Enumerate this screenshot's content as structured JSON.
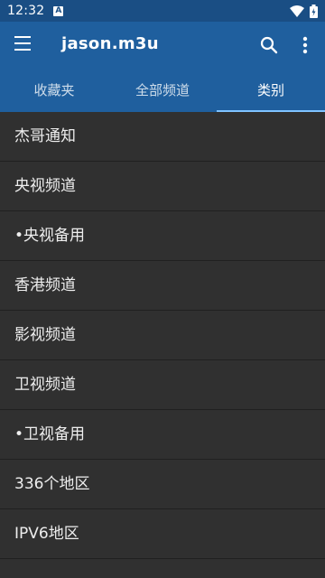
{
  "status_bar": {
    "time": "12:32",
    "notification_icon": "A"
  },
  "app_bar": {
    "title": "jason.m3u"
  },
  "tabs": [
    {
      "label": "收藏夹",
      "active": false
    },
    {
      "label": "全部频道",
      "active": false
    },
    {
      "label": "类别",
      "active": true
    }
  ],
  "categories": [
    "杰哥通知",
    "央视频道",
    "•央视备用",
    "香港频道",
    "影视频道",
    "卫视频道",
    "•卫视备用",
    "336个地区",
    "IPV6地区"
  ],
  "colors": {
    "status_bar": "#1a4e84",
    "app_bar": "#1f5f9e",
    "tab_indicator": "#7fc3ff",
    "list_background": "#303030"
  }
}
